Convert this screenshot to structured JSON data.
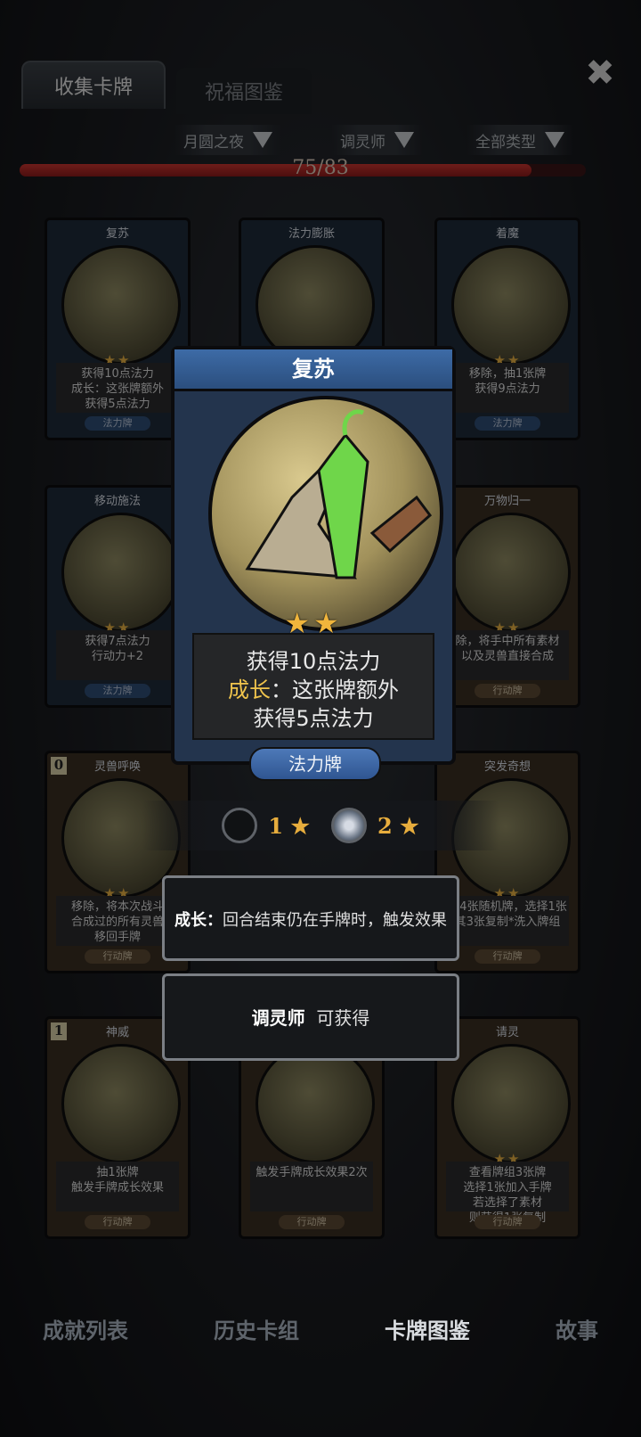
{
  "tabs": {
    "collect": "收集卡牌",
    "blessing": "祝福图鉴"
  },
  "filters": [
    "月圆之夜",
    "调灵师",
    "全部类型"
  ],
  "progress": {
    "text": "75/83",
    "fraction": 0.9036
  },
  "cards": [
    {
      "name": "复苏",
      "cost": "",
      "desc_lines": [
        "获得10点法力",
        "成长：这张牌额外",
        "获得5点法力"
      ],
      "type": "法力牌",
      "stars": "★★",
      "style": "blue"
    },
    {
      "name": "法力膨胀",
      "cost": "",
      "desc_lines": [],
      "type": "",
      "stars": "",
      "style": "blue"
    },
    {
      "name": "着魔",
      "cost": "",
      "desc_lines": [
        "移除，抽1张牌",
        "获得9点法力"
      ],
      "type": "法力牌",
      "stars": "★★",
      "style": "blue"
    },
    {
      "name": "移动施法",
      "cost": "",
      "desc_lines": [
        "获得7点法力",
        "行动力+2"
      ],
      "type": "法力牌",
      "stars": "★★",
      "style": "blue"
    },
    {
      "name": "万物归一",
      "cost": "",
      "desc_lines": [
        "除，将手中所有素材",
        "以及灵兽直接合成"
      ],
      "type": "行动牌",
      "stars": "★★",
      "style": "brown"
    },
    {
      "name": "灵兽呼唤",
      "cost": "0",
      "desc_lines": [
        "移除，将本次战斗",
        "合成过的所有灵兽",
        "移回手牌"
      ],
      "type": "行动牌",
      "stars": "★★",
      "style": "brown"
    },
    {
      "name": "突发奇想",
      "cost": "",
      "desc_lines": [
        "看4张随机牌，选择1张",
        "其3张复制*洗入牌组"
      ],
      "type": "行动牌",
      "stars": "★★",
      "style": "brown"
    },
    {
      "name": "神威",
      "cost": "1",
      "desc_lines": [
        "抽1张牌",
        "触发手牌成长效果"
      ],
      "type": "行动牌",
      "stars": "",
      "style": "brown"
    },
    {
      "name": "",
      "cost": "",
      "desc_lines": [
        "触发手牌成长效果2次"
      ],
      "type": "行动牌",
      "stars": "",
      "style": "brown"
    },
    {
      "name": "请灵",
      "cost": "0",
      "desc_lines": [
        "查看牌组3张牌",
        "选择1张加入手牌",
        "若选择了素材",
        "则获得1张复制"
      ],
      "type": "行动牌",
      "stars": "★★",
      "style": "brown"
    }
  ],
  "popup": {
    "name": "复苏",
    "stars": "★★",
    "line1": "获得10点法力",
    "grow_label": "成长",
    "line2_rest": "：这张牌额外",
    "line3": "获得5点法力",
    "type": "法力牌"
  },
  "levels": [
    {
      "num": "1",
      "star": "★"
    },
    {
      "num": "2",
      "star": "★"
    }
  ],
  "tooltip_grow": {
    "label": "成长：",
    "text": "回合结束仍在手牌时，触发效果"
  },
  "tooltip_obtain": {
    "class_name": "调灵师",
    "text": "可获得"
  },
  "nav": [
    "成就列表",
    "历史卡组",
    "卡牌图鉴",
    "故事"
  ],
  "colors": {
    "accent_gold": "#f0c44c",
    "progress_red": "#c93530",
    "blue_card": "#2b4e7e"
  }
}
